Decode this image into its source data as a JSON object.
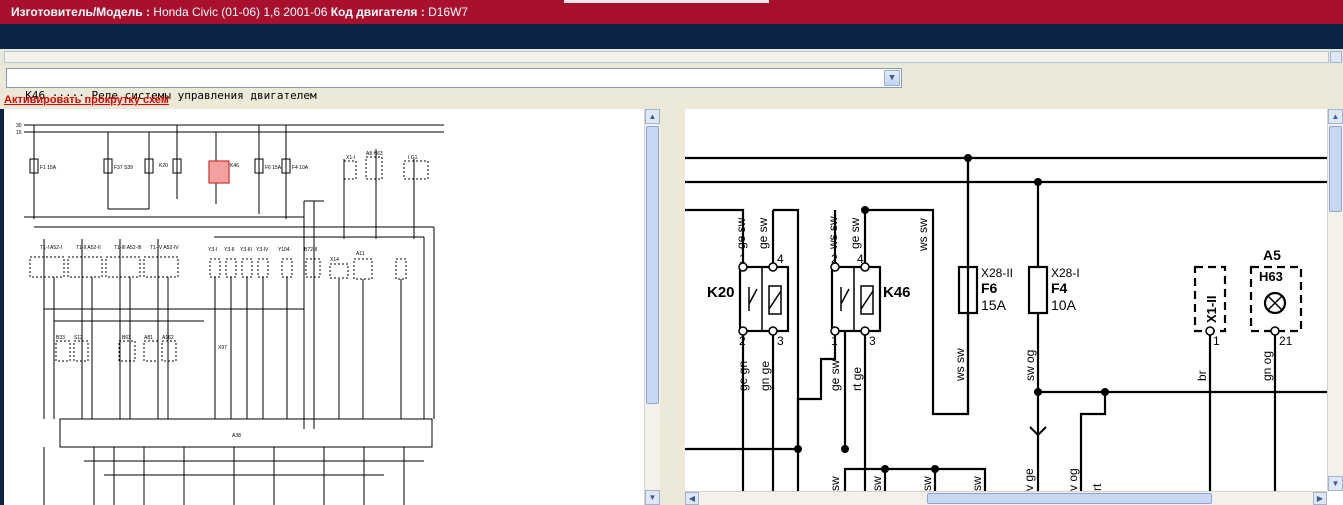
{
  "header": {
    "maker_label": "Изготовитель/Модель :",
    "maker_value": "Honda Civic (01-06) 1,6 2001-06",
    "engine_label": "Код двигателя :",
    "engine_value": "D16W7"
  },
  "selector": {
    "value": "K46 ····· Реле системы управления двигателем"
  },
  "scroll_link": "Активировать прокрутку схем",
  "left_diagram": {
    "rails": [
      "30",
      "15"
    ],
    "fuses": [
      "F1 15A",
      "F37 S39",
      "K20",
      "K46",
      "F6 15A",
      "F4 10A"
    ],
    "relays_top": [
      "T1-I A52-I",
      "T1-II A52-II",
      "T1-III A52-III",
      "T1-IV A52-IV"
    ],
    "injectors": [
      "Y3-I",
      "Y3-II",
      "Y3-III",
      "Y3-IV",
      "Y104",
      "B72-II"
    ],
    "others": [
      "A8 H63",
      "X1-I",
      "I G1",
      "X14",
      "A11",
      "B33",
      "S12",
      "B63",
      "A81",
      "A162",
      "X97",
      "A38"
    ]
  },
  "right_diagram": {
    "relay_k20": {
      "name": "K20",
      "pins": [
        "1",
        "4",
        "2",
        "3"
      ],
      "wires_top": [
        "ge sw",
        "ge sw"
      ],
      "wires_bottom": [
        "ge gn",
        "gn ge"
      ]
    },
    "relay_k46": {
      "name": "K46",
      "pins": [
        "2",
        "4",
        "1",
        "3"
      ],
      "wires_top": [
        "ws sw",
        "ge sw"
      ],
      "wires_bottom": [
        "ge sw",
        "rt ge"
      ]
    },
    "wire_mid": "ws sw",
    "fuse_f6": {
      "connector": "X28-II",
      "name": "F6",
      "rating": "15A",
      "wire": "ws sw"
    },
    "fuse_f4": {
      "connector": "X28-I",
      "name": "F4",
      "rating": "10A",
      "wire": "sw og"
    },
    "connector_x1": {
      "name": "X1-II",
      "pin": "1",
      "wire": "br"
    },
    "lamp": {
      "ref": "A5",
      "name": "H63",
      "pin": "21",
      "wire": "gn og"
    },
    "bottom_labels": [
      "sw",
      "sw",
      "sw",
      "sw",
      "v ge",
      "v og",
      "rt"
    ]
  }
}
